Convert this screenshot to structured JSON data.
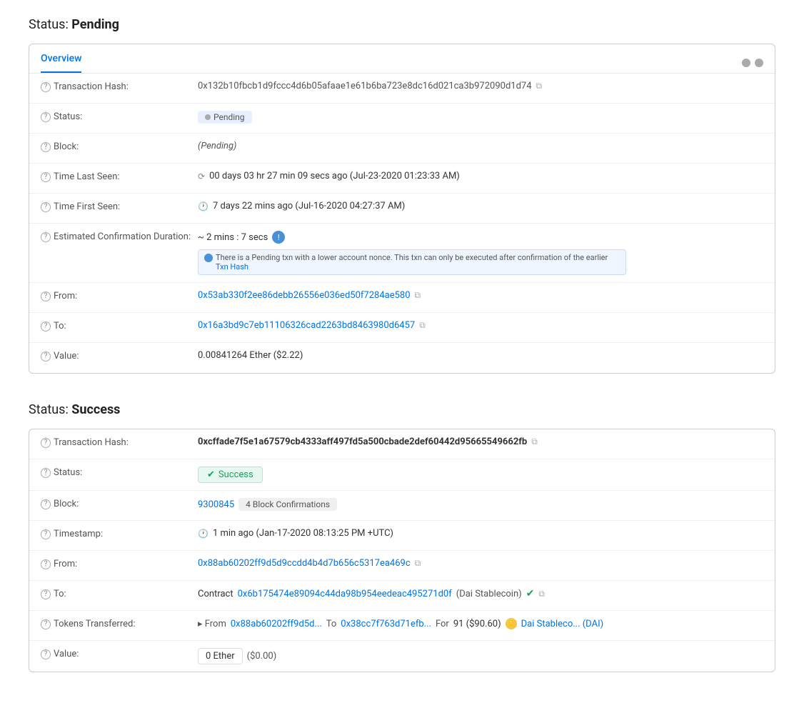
{
  "pending": {
    "section_title": "Status:",
    "section_status": "Pending",
    "tab_label": "Overview",
    "tab_dots": [
      "dot1",
      "dot2"
    ],
    "rows": {
      "tx_hash_label": "Transaction Hash:",
      "tx_hash_value": "0x132b10fbcb1d9fccc4d6b05afaae1e61b6ba723e8dc16d021ca3b972090d1d74",
      "status_label": "Status:",
      "status_value": "Pending",
      "block_label": "Block:",
      "block_value": "(Pending)",
      "time_last_label": "Time Last Seen:",
      "time_last_value": "00 days 03 hr 27 min 09 secs ago (Jul-23-2020 01:23:33 AM)",
      "time_first_label": "Time First Seen:",
      "time_first_value": "7 days 22 mins ago (Jul-16-2020 04:27:37 AM)",
      "est_label": "Estimated Confirmation Duration:",
      "est_value": "~ 2 mins : 7 secs",
      "est_note": "There is a Pending txn with a lower account nonce. This txn can only be executed after confirmation of the earlier",
      "est_note_link": "Txn Hash",
      "from_label": "From:",
      "from_value": "0x53ab330f2ee86debb26556e036ed50f7284ae580",
      "to_label": "To:",
      "to_value": "0x16a3bd9c7eb11106326cad2263bd8463980d6457",
      "value_label": "Value:",
      "value_amount": "0.00841264 Ether ($2.22)"
    }
  },
  "success": {
    "section_title": "Status:",
    "section_status": "Success",
    "rows": {
      "tx_hash_label": "Transaction Hash:",
      "tx_hash_value": "0xcffade7f5e1a67579cb4333aff497fd5a500cbade2def60442d95665549662fb",
      "status_label": "Status:",
      "status_value": "Success",
      "block_label": "Block:",
      "block_number": "9300845",
      "block_confirmations": "4 Block Confirmations",
      "timestamp_label": "Timestamp:",
      "timestamp_value": "1 min ago (Jan-17-2020 08:13:25 PM +UTC)",
      "from_label": "From:",
      "from_value": "0x88ab60202ff9d5d9ccdd4b4d7b656c5317ea469c",
      "to_label": "To:",
      "to_prefix": "Contract",
      "to_contract": "0x6b175474e89094c44da98b954eedeac495271d0f",
      "to_name": "(Dai Stablecoin)",
      "tokens_label": "Tokens Transferred:",
      "tokens_from_prefix": "▸ From",
      "tokens_from": "0x88ab60202ff9d5d...",
      "tokens_to_prefix": "To",
      "tokens_to": "0x38cc7f763d71efb...",
      "tokens_for_prefix": "For",
      "tokens_amount": "91 ($90.60)",
      "tokens_name": "Dai Stableco... (DAI)",
      "value_label": "Value:",
      "value_amount": "0 Ether",
      "value_usd": "($0.00)"
    }
  }
}
